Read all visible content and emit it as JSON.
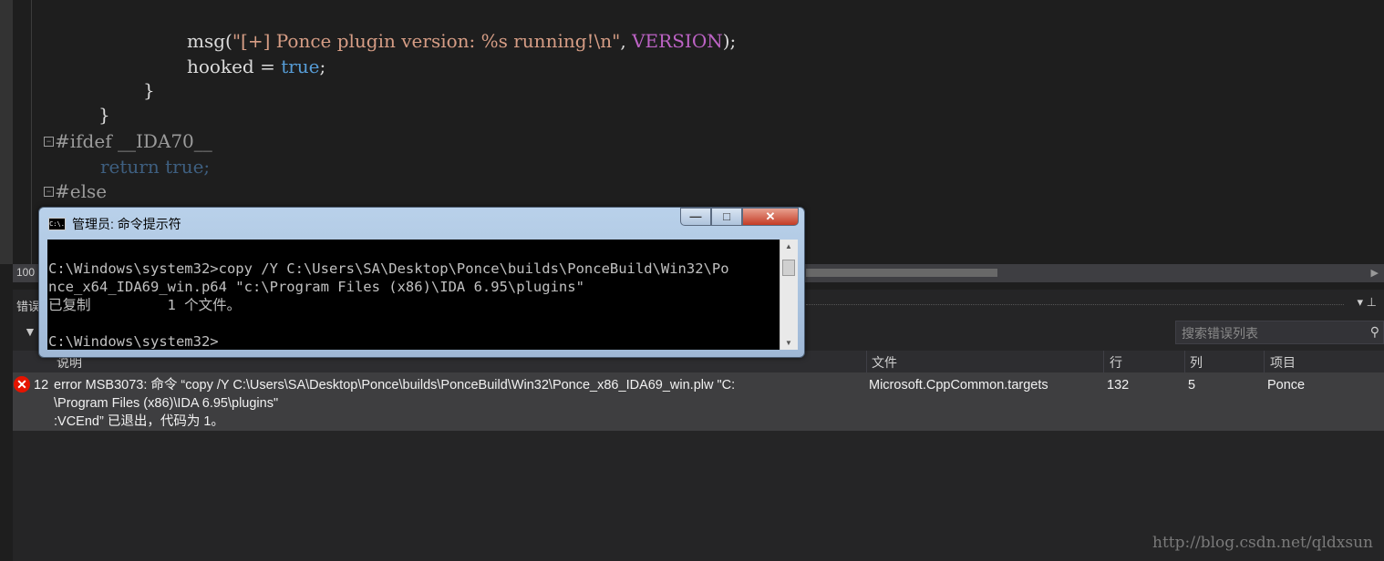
{
  "editor": {
    "lines": {
      "l1_prefix": "msg(",
      "l1_string": "\"[+] Ponce plugin version: %s running!\\n\"",
      "l1_sep": ", ",
      "l1_macro": "VERSION",
      "l1_end": ");",
      "l2_var": "hooked = ",
      "l2_kw": "true",
      "l2_end": ";",
      "l3": "}",
      "l4": "}",
      "l5": "#ifdef __IDA70__",
      "l6_kw": "return true;",
      "l7": "#else"
    }
  },
  "status_bar": {
    "zoom": "100"
  },
  "error_panel": {
    "title": "错误",
    "search_placeholder": "搜索错误列表",
    "columns": [
      "说明",
      "文件",
      "行",
      "列",
      "项目"
    ],
    "row": {
      "index": "12",
      "description_line1": "error MSB3073: 命令 “copy /Y C:\\Users\\SA\\Desktop\\Ponce\\builds\\PonceBuild\\Win32\\Ponce_x86_IDA69_win.plw \"C:",
      "description_line2": "\\Program Files (x86)\\IDA 6.95\\plugins\"",
      "description_line3": ":VCEnd” 已退出，代码为 1。",
      "file": "Microsoft.CppCommon.targets",
      "line": "132",
      "column": "5",
      "project": "Ponce"
    }
  },
  "cmd_window": {
    "title": "管理员: 命令提示符",
    "icon_text": "C:\\.",
    "console_lines": [
      "C:\\Windows\\system32>copy /Y C:\\Users\\SA\\Desktop\\Ponce\\builds\\PonceBuild\\Win32\\Po",
      "nce_x64_IDA69_win.p64 \"c:\\Program Files (x86)\\IDA 6.95\\plugins\"",
      "已复制         1 个文件。",
      "",
      "C:\\Windows\\system32>"
    ]
  },
  "watermark": "http://blog.csdn.net/qldxsun"
}
